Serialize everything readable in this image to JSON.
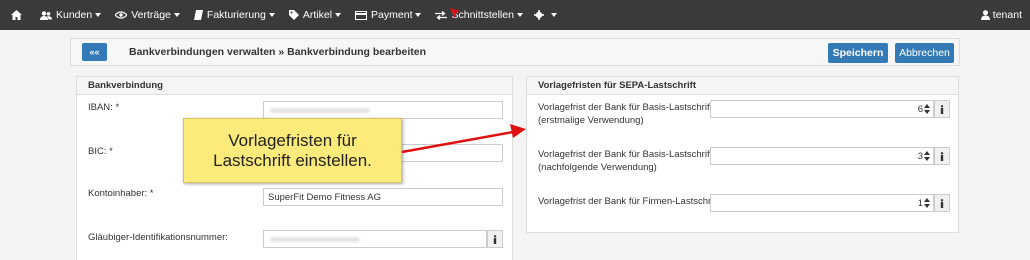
{
  "nav": {
    "home_icon": "home-icon",
    "items": [
      {
        "label": "Kunden",
        "icon": "users-icon"
      },
      {
        "label": "Verträge",
        "icon": "eye-icon"
      },
      {
        "label": "Fakturierung",
        "icon": "book-icon"
      },
      {
        "label": "Artikel",
        "icon": "tag-icon"
      },
      {
        "label": "Payment",
        "icon": "card-icon"
      },
      {
        "label": "Schnittstellen",
        "icon": "exchange-icon"
      }
    ],
    "settings_icon": "gear-icon",
    "user_label": "tenant"
  },
  "header": {
    "back_label": "««",
    "breadcrumb": "Bankverbindungen verwalten » Bankverbindung bearbeiten",
    "save_label": "Speichern",
    "cancel_label": "Abbrechen"
  },
  "bank_panel": {
    "title": "Bankverbindung",
    "iban_label": "IBAN: *",
    "bic_label": "BIC: *",
    "owner_label": "Kontoinhaber: *",
    "owner_value": "SuperFit Demo Fitness AG",
    "creditor_label": "Gläubiger-Identifikationsnummer:"
  },
  "sepa_panel": {
    "title": "Vorlagefristen für SEPA-Lastschrift",
    "fields": [
      {
        "label_line1": "Vorlagefrist der Bank für Basis-Lastschriften",
        "label_line2": "(erstmalige Verwendung)",
        "value": "6"
      },
      {
        "label_line1": "Vorlagefrist der Bank für Basis-Lastschriften",
        "label_line2": "(nachfolgende Verwendung)",
        "value": "3"
      },
      {
        "label_line1": "Vorlagefrist der Bank für Firmen-Lastschriften",
        "label_line2": "",
        "value": "1"
      }
    ]
  },
  "callout": {
    "line1": "Vorlagefristen für",
    "line2": "Lastschrift einstellen."
  },
  "colors": {
    "navbar": "#3a3a3a",
    "primary": "#337ab7",
    "callout": "#fcea7a",
    "arrow": "#e01010"
  }
}
